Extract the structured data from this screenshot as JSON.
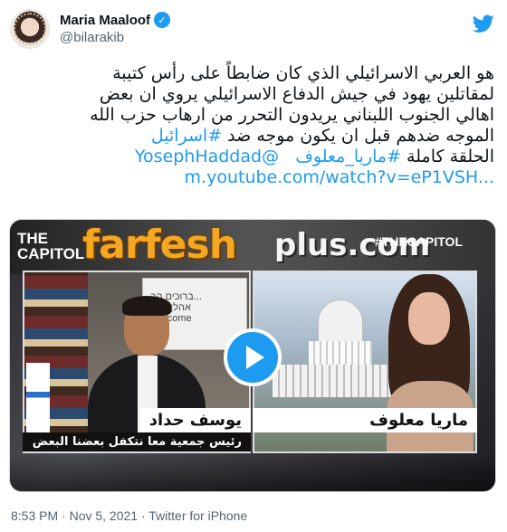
{
  "author": {
    "display_name": "Maria Maaloof",
    "handle": "@bilarakib",
    "verified": true
  },
  "tweet": {
    "lines": [
      "هو العربي الاسرائيلي الذي كان ضابطاً على رأس كتيبة",
      "لمقاتلين يهود في جيش الدفاع الاسرائيلي يروي ان بعض",
      "اهالي الجنوب اللبناني يريدون التحرر من ارهاب حزب الله",
      "الموجه ضدهم قبل ان يكون موجه ضد"
    ],
    "hashtag_israel": "#اسرائيل",
    "mention": "@YosephHaddad",
    "hashtag_maria": "#ماريا_معلوف",
    "full_episode": "الحلقة كاملة",
    "url": "m.youtube.com/watch?v=eP1VSH..."
  },
  "media": {
    "watermark_main": "farfesh",
    "watermark_plus": "plus.com",
    "show_logo_top": "THE",
    "show_logo_bottom": "CAPITOL",
    "hashtag_corner": "#THECAPITOL",
    "whiteboard_text": "ברוכים הב...\n...אהלן וס\nWelcome",
    "guest_name": "يوسف حداد",
    "guest_title": "رئيس جمعية معا نتكفل بعضنا البعض",
    "host_name": "ماريا معلوف",
    "play_icon": "play-icon"
  },
  "meta": {
    "timestamp": "8:53 PM · Nov 5, 2021 · Twitter for iPhone"
  },
  "colors": {
    "link": "#1d9bf0",
    "verified": "#1d9bf0",
    "secondary_text": "#536471",
    "watermark": "#f3a722"
  }
}
